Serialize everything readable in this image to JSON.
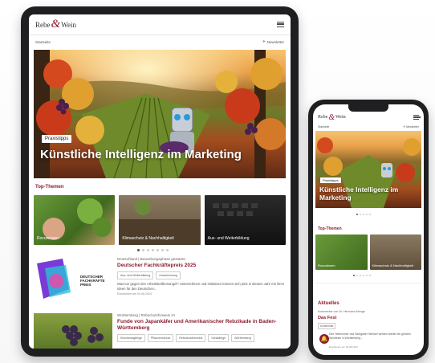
{
  "brand": {
    "name_left": "Rebe",
    "amp": "&",
    "name_right": "Wein",
    "accent": "#8c1c2e"
  },
  "subbar": {
    "left": "Startseite",
    "right": "Newsletter"
  },
  "hero": {
    "tag": "Praxistipps",
    "title": "Künstliche Intelligenz im Marketing"
  },
  "top_themen": {
    "heading": "Top-Themen",
    "cards": [
      {
        "label": "Rocuwissen"
      },
      {
        "label": "Klimaschutz & Nachhaltigkeit"
      },
      {
        "label": "Aus- und Weiterbildung"
      }
    ]
  },
  "articles": [
    {
      "kicker": "Deutschland | Bewerbungsphase gestartet",
      "title": "Deutscher Fachkräftepreis 2025",
      "chips": [
        "Aus- und Weiterbildung",
        "Auszeichnung"
      ],
      "text": "Was tun gegen den Arbeitskräftemangel? Unternehmen und Initiativen können sich jetzt in diesem Jahr mit ihren Ideen für den Deutschen...",
      "date": "Erschienen am 04.08.2024",
      "thumb_caption": "DEUTSCHER FACHKRÄFTE PREIS"
    },
    {
      "kicker": "Württemberg | Rebschutzhinweis 21",
      "title": "Funde von Japankäfer und Amerikanischer Rebzikade in Baden-Württemberg",
      "chips": [
        "Kirschessigfliege",
        "Pflanzenschutz",
        "Rebschutzhinweis",
        "Schädlinge",
        "Württemberg"
      ]
    }
  ],
  "phone": {
    "subbar": {
      "left": "Startseite",
      "right": "Newsletter"
    },
    "hero": {
      "tag": "Praxistipps",
      "title": "Künstliche Intelligenz im Marketing"
    },
    "top_themen": {
      "heading": "Top-Themen",
      "cards": [
        {
          "label": "Rocuwissen"
        },
        {
          "label": "Klimaschutz & Nachhaltigkeit"
        }
      ]
    },
    "aktuell": {
      "heading": "Aktuelles",
      "kicker": "Kommentar von Dr. Hermann Menge",
      "title": "Das Fest",
      "chip": "Kommentar",
      "text": "Den Heilbronner und Stuttgarter Weinorf werden wieder die größten Weinfeste in Württemberg...",
      "date": "Erschienen am 04.08.2024"
    }
  }
}
